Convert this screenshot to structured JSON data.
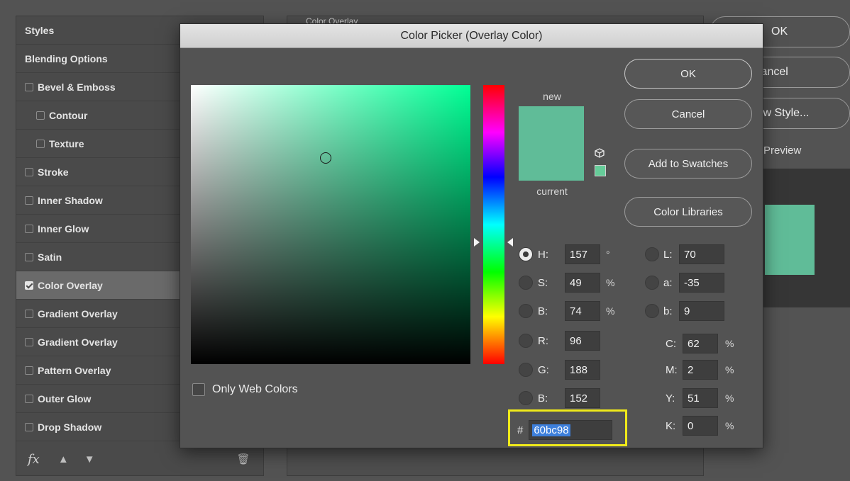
{
  "layer_style": {
    "styles_items": [
      {
        "label": "Styles",
        "checkbox": false,
        "checked": false,
        "indent": 0,
        "selected": false
      },
      {
        "label": "Blending Options",
        "checkbox": false,
        "checked": false,
        "indent": 0,
        "selected": false
      },
      {
        "label": "Bevel & Emboss",
        "checkbox": true,
        "checked": false,
        "indent": 0,
        "selected": false
      },
      {
        "label": "Contour",
        "checkbox": true,
        "checked": false,
        "indent": 1,
        "selected": false
      },
      {
        "label": "Texture",
        "checkbox": true,
        "checked": false,
        "indent": 1,
        "selected": false
      },
      {
        "label": "Stroke",
        "checkbox": true,
        "checked": false,
        "indent": 0,
        "selected": false
      },
      {
        "label": "Inner Shadow",
        "checkbox": true,
        "checked": false,
        "indent": 0,
        "selected": false
      },
      {
        "label": "Inner Glow",
        "checkbox": true,
        "checked": false,
        "indent": 0,
        "selected": false
      },
      {
        "label": "Satin",
        "checkbox": true,
        "checked": false,
        "indent": 0,
        "selected": false
      },
      {
        "label": "Color Overlay",
        "checkbox": true,
        "checked": true,
        "indent": 0,
        "selected": true
      },
      {
        "label": "Gradient Overlay",
        "checkbox": true,
        "checked": false,
        "indent": 0,
        "selected": false
      },
      {
        "label": "Gradient Overlay",
        "checkbox": true,
        "checked": false,
        "indent": 0,
        "selected": false
      },
      {
        "label": "Pattern Overlay",
        "checkbox": true,
        "checked": false,
        "indent": 0,
        "selected": false
      },
      {
        "label": "Outer Glow",
        "checkbox": true,
        "checked": false,
        "indent": 0,
        "selected": false
      },
      {
        "label": "Drop Shadow",
        "checkbox": true,
        "checked": false,
        "indent": 0,
        "selected": false
      }
    ],
    "footer": {
      "fx": "fx",
      "up_icon": "arrow-up-icon",
      "down_icon": "arrow-down-icon",
      "trash_icon": "trash-icon"
    },
    "section_title": "Color Overlay",
    "buttons": {
      "ok": "OK",
      "cancel": "Cancel",
      "new_style": "New Style...",
      "preview": "Preview"
    },
    "preview_color": "#60bc98"
  },
  "color_picker": {
    "title": "Color Picker (Overlay Color)",
    "new_label": "new",
    "current_label": "current",
    "new_color": "#60bc98",
    "current_color": "#60bc98",
    "buttons": {
      "ok": "OK",
      "cancel": "Cancel",
      "add_to_swatches": "Add to Swatches",
      "color_libraries": "Color Libraries"
    },
    "hsb": {
      "h": {
        "label": "H:",
        "value": "157",
        "unit": "°"
      },
      "s": {
        "label": "S:",
        "value": "49",
        "unit": "%"
      },
      "b": {
        "label": "B:",
        "value": "74",
        "unit": "%"
      }
    },
    "rgb": {
      "r": {
        "label": "R:",
        "value": "96"
      },
      "g": {
        "label": "G:",
        "value": "188"
      },
      "b": {
        "label": "B:",
        "value": "152"
      }
    },
    "lab": {
      "l": {
        "label": "L:",
        "value": "70"
      },
      "a": {
        "label": "a:",
        "value": "-35"
      },
      "b": {
        "label": "b:",
        "value": "9"
      }
    },
    "cmyk": {
      "c": {
        "label": "C:",
        "value": "62",
        "unit": "%"
      },
      "m": {
        "label": "M:",
        "value": "2",
        "unit": "%"
      },
      "y": {
        "label": "Y:",
        "value": "51",
        "unit": "%"
      },
      "k": {
        "label": "K:",
        "value": "0",
        "unit": "%"
      }
    },
    "hex_prefix": "#",
    "hex_value": "60bc98",
    "only_web_colors": "Only Web Colors",
    "selected_mode": "H",
    "hue_color": "#00ff95",
    "web_safe_color": "#66cc99",
    "highlight_color": "#f0ea1a"
  }
}
